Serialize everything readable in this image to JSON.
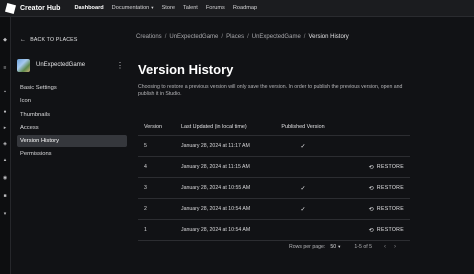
{
  "topbar": {
    "brand": "Creator Hub",
    "nav": [
      {
        "label": "Dashboard",
        "active": true,
        "dropdown": false
      },
      {
        "label": "Documentation",
        "active": false,
        "dropdown": true
      },
      {
        "label": "Store",
        "active": false,
        "dropdown": false
      },
      {
        "label": "Talent",
        "active": false,
        "dropdown": false
      },
      {
        "label": "Forums",
        "active": false,
        "dropdown": false
      },
      {
        "label": "Roadmap",
        "active": false,
        "dropdown": false
      }
    ]
  },
  "sidebar": {
    "back_label": "BACK TO PLACES",
    "experience_name": "UnExpectedGame",
    "items": [
      {
        "label": "Basic Settings"
      },
      {
        "label": "Icon"
      },
      {
        "label": "Thumbnails"
      },
      {
        "label": "Access"
      },
      {
        "label": "Version History",
        "selected": true
      },
      {
        "label": "Permissions"
      }
    ]
  },
  "breadcrumb": {
    "items": [
      "Creations",
      "UnExpectedGame",
      "Places",
      "UnExpectedGame",
      "Version History"
    ],
    "separator": "/"
  },
  "page": {
    "title": "Version History",
    "description": "Choosing to restore a previous version will only save the version. In order to publish the previous version, open and publish it in Studio."
  },
  "table": {
    "headers": {
      "version": "Version",
      "updated": "Last Updated (in local time)",
      "published": "Published Version"
    },
    "restore_label": "RESTORE",
    "rows": [
      {
        "version": "5",
        "updated": "January 28, 2024 at 11:17 AM",
        "published": true,
        "restorable": false
      },
      {
        "version": "4",
        "updated": "January 28, 2024 at 11:15 AM",
        "published": false,
        "restorable": true
      },
      {
        "version": "3",
        "updated": "January 28, 2024 at 10:55 AM",
        "published": true,
        "restorable": true
      },
      {
        "version": "2",
        "updated": "January 28, 2024 at 10:54 AM",
        "published": true,
        "restorable": true
      },
      {
        "version": "1",
        "updated": "January 28, 2024 at 10:54 AM",
        "published": false,
        "restorable": true
      }
    ]
  },
  "pagination": {
    "rows_per_page_label": "Rows per page:",
    "rows_per_page_value": "50",
    "range": "1-5 of 5"
  },
  "colors": {
    "background": "#111215",
    "selected_item": "#35373c",
    "topbar": "#1b1c1f"
  }
}
